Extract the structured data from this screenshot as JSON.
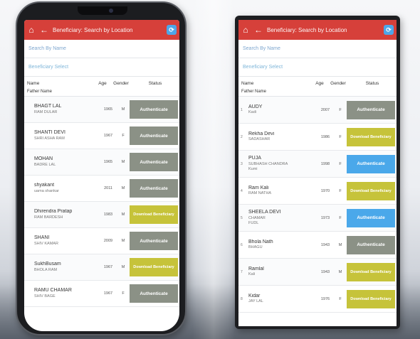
{
  "screen_left": {
    "appbar": {
      "home_icon": "home-icon",
      "back_icon": "back-arrow-icon",
      "title": "Beneficiary: Search by Location",
      "sync_icon": "sync-icon"
    },
    "search_placeholder": "Search By Name",
    "select_label": "Beneficiary Select",
    "columns": {
      "name": "Name",
      "age": "Age",
      "gender": "Gender",
      "status": "Status"
    },
    "subheader": "Father Name",
    "rows": [
      {
        "name": "BHAGT LAL",
        "father": "RAM DULAR",
        "age": "1965",
        "gender": "M",
        "status": "Authenticate",
        "kind": "auth"
      },
      {
        "name": "SHANTI DEVI",
        "father": "SHRI ASHA RAM",
        "age": "1967",
        "gender": "F",
        "status": "Authenticate",
        "kind": "auth"
      },
      {
        "name": "MOHAN",
        "father": "BADRE LAL",
        "age": "1965",
        "gender": "M",
        "status": "Authenticate",
        "kind": "auth"
      },
      {
        "name": "shyakant",
        "father": "uama shankar",
        "age": "2011",
        "gender": "M",
        "status": "Authenticate",
        "kind": "auth"
      },
      {
        "name": "Dhirendra Pratap",
        "father": "RAM BARDESH",
        "age": "1983",
        "gender": "M",
        "status": "Download Beneficiary",
        "kind": "dl"
      },
      {
        "name": "SHANI",
        "father": "SHIV KAMAR",
        "age": "2009",
        "gender": "M",
        "status": "Authenticate",
        "kind": "auth"
      },
      {
        "name": "SukhBusam",
        "father": "BHOLA RAM",
        "age": "1967",
        "gender": "M",
        "status": "Download Beneficiary",
        "kind": "dl"
      },
      {
        "name": "RAMU CHAMAR",
        "father": "SHIV BAGE",
        "age": "1967",
        "gender": "F",
        "status": "Authenticate",
        "kind": "auth"
      }
    ]
  },
  "screen_right": {
    "appbar": {
      "home_icon": "home-icon",
      "back_icon": "back-arrow-icon",
      "title": "Beneficiary: Search by Location",
      "sync_icon": "sync-icon"
    },
    "search_placeholder": "Search By Name",
    "select_label": "Beneficiary Select",
    "columns": {
      "name": "Name",
      "age": "Age",
      "gender": "Gender",
      "status": "Status"
    },
    "subheader": "Father Name",
    "rows": [
      {
        "idx": "1",
        "name": "AUDY",
        "father": "Kadi",
        "age": "2007",
        "gender": "F",
        "status": "Authenticate",
        "kind": "auth"
      },
      {
        "idx": "2",
        "name": "Rekha Devi",
        "father": "SADASHAR",
        "age": "1986",
        "gender": "F",
        "status": "Download Beneficiary",
        "kind": "dl"
      },
      {
        "idx": "3",
        "name": "PUJA",
        "father": "SUBHASH CHANDRA",
        "extra": "Kumi",
        "age": "1998",
        "gender": "F",
        "status": "Authenticate",
        "kind": "blue"
      },
      {
        "idx": "4",
        "name": "Ram Kali",
        "father": "RAM NATHA",
        "age": "1970",
        "gender": "F",
        "status": "Download Beneficiary",
        "kind": "dl"
      },
      {
        "idx": "5",
        "name": "SHEELA DEVI",
        "father": "CHAMAR",
        "extra": "FUDL",
        "age": "1973",
        "gender": "F",
        "status": "Authenticate",
        "kind": "blue"
      },
      {
        "idx": "6",
        "name": "Bhola Nath",
        "father": "BHAGU",
        "age": "1943",
        "gender": "M",
        "status": "Authenticate",
        "kind": "auth"
      },
      {
        "idx": "7",
        "name": "Ramlal",
        "father": "Kali",
        "age": "1943",
        "gender": "M",
        "status": "Download Beneficiary",
        "kind": "dl"
      },
      {
        "idx": "8",
        "name": "Kidar",
        "father": "JAY LAL",
        "age": "1976",
        "gender": "F",
        "status": "Download Beneficiary",
        "kind": "dl"
      }
    ]
  },
  "colors": {
    "appbar": "#d6403a",
    "authenticate": "#8b9186",
    "download": "#c6c33a",
    "authenticate_blue": "#4aa8ea"
  }
}
